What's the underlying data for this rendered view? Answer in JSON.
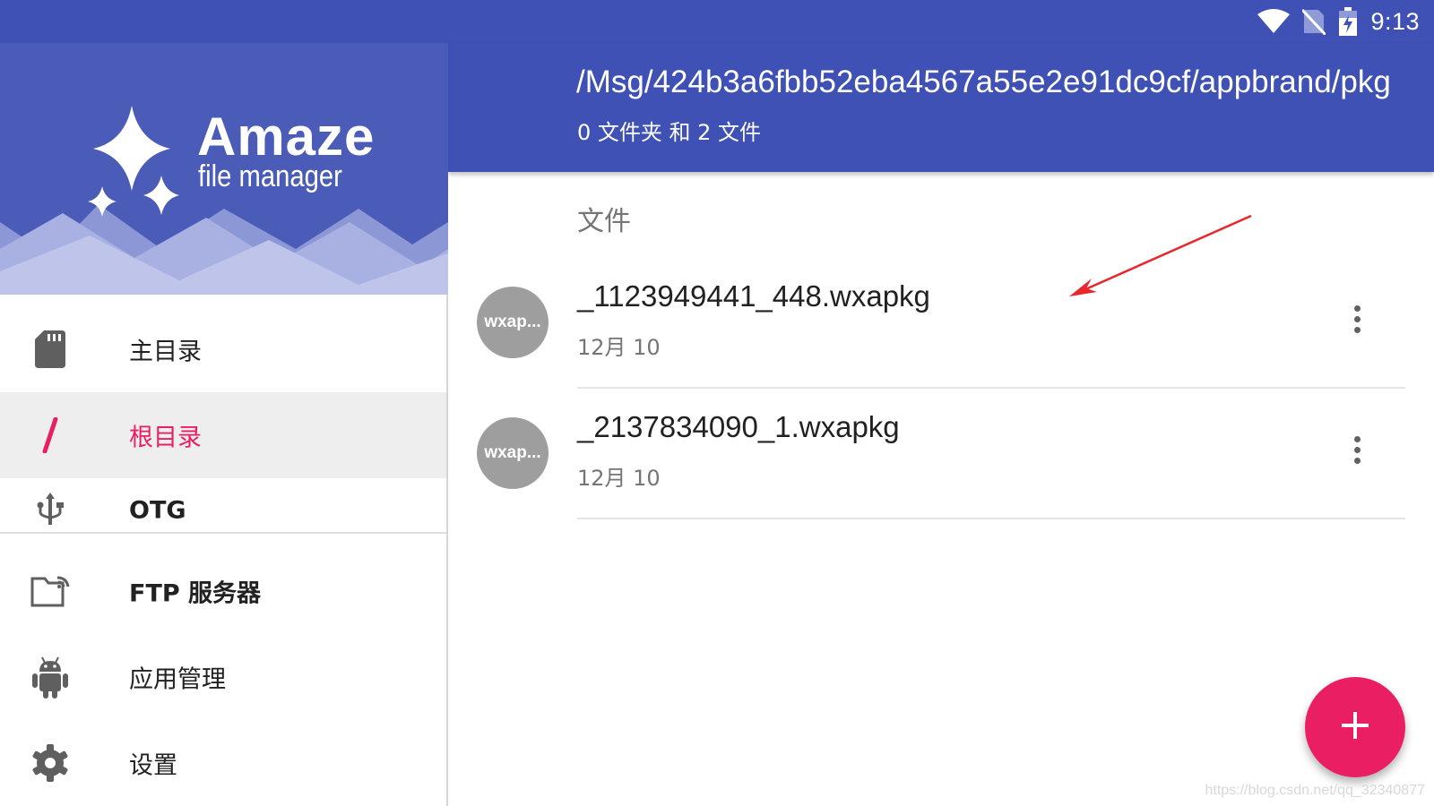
{
  "status_bar": {
    "time": "9:13",
    "icons": [
      "wifi-icon",
      "no-sim-icon",
      "battery-charging-icon"
    ]
  },
  "app_bar": {
    "path": "/Msg/424b3a6fbb52eba4567a55e2e91dc9cf/appbrand/pkg",
    "summary": "0 文件夹 和 2 文件",
    "color": "#3f51b5"
  },
  "drawer": {
    "brand_title": "Amaze",
    "brand_subtitle": "file manager",
    "items": [
      {
        "label": "主目录",
        "icon": "sd-card-icon"
      },
      {
        "label": "根目录",
        "icon": "slash-icon",
        "active": true
      },
      {
        "label": "OTG",
        "icon": "usb-icon"
      },
      {
        "label": "FTP 服务器",
        "icon": "ftp-folder-icon"
      },
      {
        "label": "应用管理",
        "icon": "android-icon"
      },
      {
        "label": "设置",
        "icon": "gear-icon"
      }
    ],
    "accent_color": "#e91e63"
  },
  "content": {
    "section_header": "文件",
    "files": [
      {
        "thumb": "wxap...",
        "name": "_1123949441_448.wxapkg",
        "date": "12月 10"
      },
      {
        "thumb": "wxap...",
        "name": "_2137834090_1.wxapkg",
        "date": "12月 10"
      }
    ]
  },
  "fab": {
    "icon": "plus-icon",
    "color": "#e91e63"
  },
  "watermark": "https://blog.csdn.net/qq_32340877"
}
